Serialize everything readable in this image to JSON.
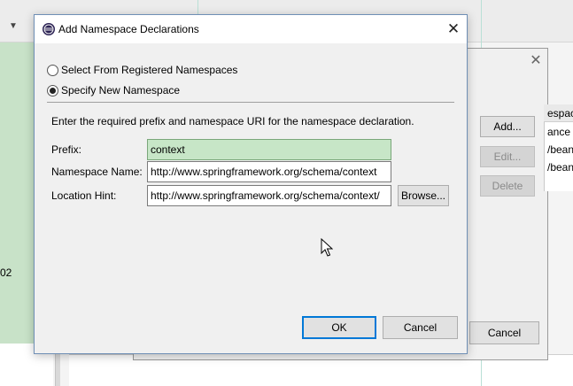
{
  "background": {
    "side_text": "02",
    "parent_dialog": {
      "table_header": "espac",
      "table_rows": [
        "ance",
        "/bean",
        "/bean"
      ],
      "buttons": {
        "add": "Add...",
        "edit": "Edit...",
        "delete": "Delete"
      },
      "cancel": "Cancel",
      "close_glyph": "✕"
    }
  },
  "dialog": {
    "title": "Add Namespace Declarations",
    "close_glyph": "✕",
    "radio_registered": "Select From Registered Namespaces",
    "radio_new": "Specify New Namespace",
    "selected_radio": "radio_new",
    "instructions": "Enter the required prefix and namespace URI for the namespace declaration.",
    "prefix_label": "Prefix:",
    "prefix_value": "context",
    "namespace_label": "Namespace Name:",
    "namespace_value": "http://www.springframework.org/schema/context",
    "location_label": "Location Hint:",
    "location_value": "http://www.springframework.org/schema/context/",
    "browse": "Browse...",
    "ok": "OK",
    "cancel": "Cancel"
  },
  "colors": {
    "focused_field": "#c7e6c7",
    "default_button_border": "#0078d7",
    "ide_green_panel": "#c8e2c8"
  },
  "icons": {
    "app": "eclipse-icon",
    "close": "close-icon",
    "cursor": "mouse-cursor-icon"
  }
}
